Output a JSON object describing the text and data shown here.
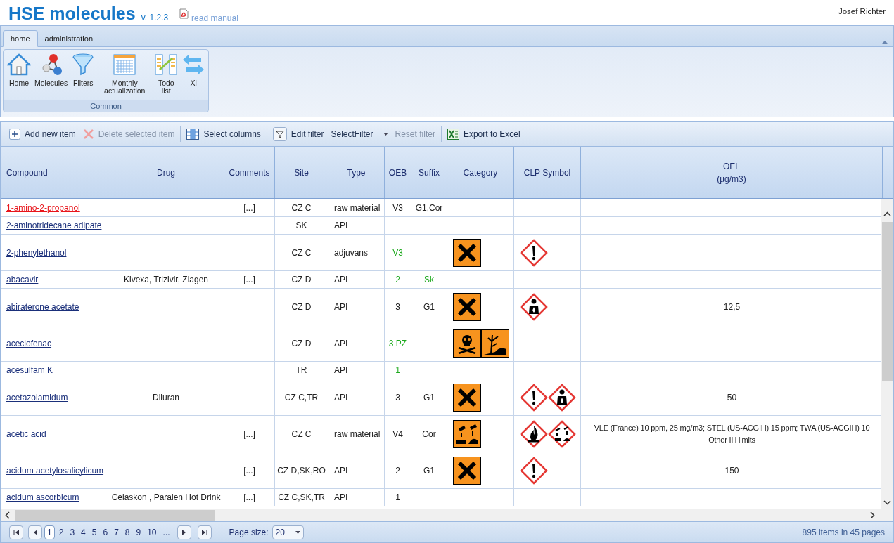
{
  "app": {
    "title": "HSE molecules",
    "version": "v. 1.2.3",
    "manual_link": "read manual",
    "user": "Josef Richter"
  },
  "ribbon": {
    "tabs": [
      {
        "label": "home",
        "selected": true
      },
      {
        "label": "administration",
        "selected": false
      }
    ],
    "group": {
      "title": "Common",
      "buttons": [
        {
          "kind": "home",
          "label": "Home"
        },
        {
          "kind": "molecules",
          "label": "Molecules"
        },
        {
          "kind": "filters",
          "label": "Filters"
        },
        {
          "kind": "calendar",
          "label": "Monthly actualization"
        },
        {
          "kind": "todo",
          "label": "Todo list"
        },
        {
          "kind": "xl",
          "label": "Xl"
        }
      ]
    }
  },
  "toolbar": [
    {
      "kind": "add",
      "label": "Add new item",
      "disabled": false
    },
    {
      "kind": "delete",
      "label": "Delete selected item",
      "disabled": true
    },
    {
      "kind": "columns",
      "label": "Select columns",
      "disabled": false
    },
    {
      "kind": "filter",
      "label": "Edit filter",
      "disabled": false
    },
    {
      "kind": "dropdown",
      "label": "SelectFilter",
      "disabled": false
    },
    {
      "kind": "reset",
      "label": "Reset filter",
      "disabled": true
    },
    {
      "kind": "excel",
      "label": "Export to Excel",
      "disabled": false
    }
  ],
  "table": {
    "columns": [
      {
        "label": "Compound"
      },
      {
        "label": "Drug"
      },
      {
        "label": "Comments"
      },
      {
        "label": "Site"
      },
      {
        "label": "Type"
      },
      {
        "label": "OEB"
      },
      {
        "label": "Suffix"
      },
      {
        "label": "Category"
      },
      {
        "label": "CLP Symbol"
      },
      {
        "label": "OEL",
        "sub": "(µg/m3)"
      }
    ],
    "rows": [
      {
        "compound": "1-amino-2-propanol",
        "flagged": true,
        "comments": "[...]",
        "site": "CZ C",
        "type": "raw material",
        "oeb": "V3",
        "oeb_highlighted": false,
        "suffix": "G1,Cor",
        "suffix_highlighted": false
      },
      {
        "compound": "2-aminotridecane adipate",
        "flagged": false,
        "site": "SK",
        "type": "API"
      },
      {
        "compound": "2-phenylethanol",
        "flagged": false,
        "site": "CZ C",
        "type": "adjuvans",
        "oeb": "V3",
        "oeb_highlighted": true,
        "category": [
          {
            "kind": "harmful"
          }
        ],
        "clp": [
          {
            "kind": "exclamation"
          }
        ]
      },
      {
        "compound": "abacavir",
        "flagged": false,
        "drug": "Kivexa, Trizivir, Ziagen",
        "comments": "[...]",
        "site": "CZ D",
        "type": "API",
        "oeb": "2",
        "oeb_highlighted": true,
        "suffix": "Sk",
        "suffix_highlighted": true
      },
      {
        "compound": "abiraterone acetate",
        "flagged": false,
        "site": "CZ D",
        "type": "API",
        "oeb": "3",
        "oeb_highlighted": false,
        "suffix": "G1",
        "suffix_highlighted": false,
        "category": [
          {
            "kind": "harmful"
          }
        ],
        "clp": [
          {
            "kind": "health"
          }
        ],
        "oel": [
          "12,5"
        ]
      },
      {
        "compound": "aceclofenac",
        "flagged": false,
        "site": "CZ D",
        "type": "API",
        "oeb": "3 PZ",
        "oeb_highlighted": true,
        "category": [
          {
            "kind": "toxic"
          },
          {
            "kind": "environment"
          }
        ]
      },
      {
        "compound": "acesulfam K",
        "flagged": false,
        "site": "TR",
        "type": "API",
        "oeb": "1",
        "oeb_highlighted": true
      },
      {
        "compound": "acetazolamidum",
        "flagged": false,
        "drug": "Diluran",
        "site": "CZ C,TR",
        "type": "API",
        "oeb": "3",
        "oeb_highlighted": false,
        "suffix": "G1",
        "suffix_highlighted": false,
        "category": [
          {
            "kind": "harmful"
          }
        ],
        "clp": [
          {
            "kind": "exclamation"
          },
          {
            "kind": "health"
          }
        ],
        "oel": [
          "50"
        ]
      },
      {
        "compound": "acetic acid",
        "flagged": false,
        "comments": "[...]",
        "site": "CZ C",
        "type": "raw material",
        "oeb": "V4",
        "oeb_highlighted": false,
        "suffix": "Cor",
        "suffix_highlighted": false,
        "category": [
          {
            "kind": "corrosive"
          }
        ],
        "clp": [
          {
            "kind": "flame"
          },
          {
            "kind": "corrosion"
          }
        ],
        "oel": [
          "VLE (France) 10 ppm, 25 mg/m3; STEL (US-ACGIH) 15 ppm; TWA (US-ACGIH) 10",
          "Other IH limits"
        ]
      },
      {
        "compound": "acidum acetylosalicylicum",
        "flagged": false,
        "comments": "[...]",
        "site": "CZ D,SK,RO",
        "type": "API",
        "oeb": "2",
        "oeb_highlighted": false,
        "suffix": "G1",
        "suffix_highlighted": false,
        "category": [
          {
            "kind": "harmful"
          }
        ],
        "clp": [
          {
            "kind": "exclamation"
          }
        ],
        "oel": [
          "150"
        ]
      },
      {
        "compound": "acidum ascorbicum",
        "flagged": false,
        "drug": "Celaskon , Paralen Hot Drink",
        "comments": "[...]",
        "site": "CZ C,SK,TR",
        "type": "API",
        "oeb": "1",
        "oeb_highlighted": false
      }
    ]
  },
  "pager": {
    "pages": [
      {
        "label": "1",
        "selected": true
      },
      {
        "label": "2",
        "selected": false
      },
      {
        "label": "3",
        "selected": false
      },
      {
        "label": "4",
        "selected": false
      },
      {
        "label": "5",
        "selected": false
      },
      {
        "label": "6",
        "selected": false
      },
      {
        "label": "7",
        "selected": false
      },
      {
        "label": "8",
        "selected": false
      },
      {
        "label": "9",
        "selected": false
      },
      {
        "label": "10",
        "selected": false
      },
      {
        "label": "...",
        "selected": false
      }
    ],
    "page_size_label": "Page size:",
    "page_size": "20",
    "summary": "895 items in 45 pages"
  }
}
